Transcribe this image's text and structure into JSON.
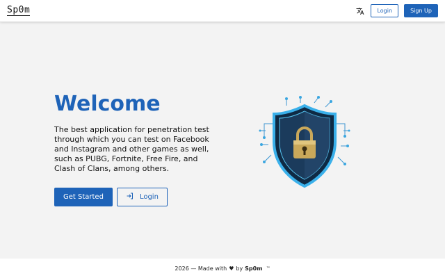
{
  "navbar": {
    "logo": "Sp0m",
    "translate_icon": "translate-icon",
    "login_label": "Login",
    "signup_label": "Sign Up"
  },
  "hero": {
    "title": "Welcome",
    "description": "The best application for penetration test through which you can test on Facebook and Instagram and other games as well, such as PUBG, Fortnite, Free Fire, and Clash of Clans, among others.",
    "get_started_label": "Get Started",
    "login_label": "Login",
    "login_icon": "login-icon",
    "illustration_icon": "shield-lock-icon"
  },
  "footer": {
    "prefix": "2026 — Made with",
    "heart": "♥",
    "by": "by",
    "brand": "Sp0m",
    "tm": "™"
  },
  "colors": {
    "primary": "#1e63b8",
    "background": "#f3f3f3",
    "surface": "#ffffff"
  }
}
